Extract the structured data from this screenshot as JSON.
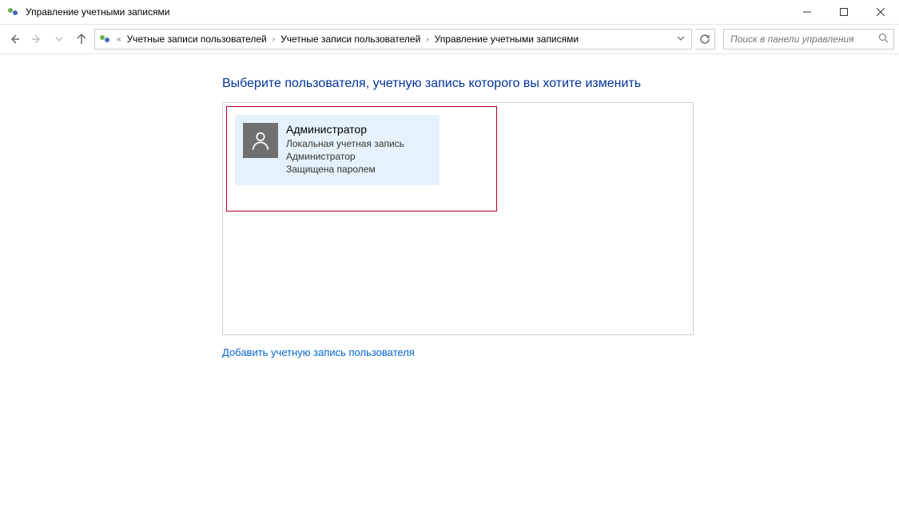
{
  "window": {
    "title": "Управление учетными записями"
  },
  "breadcrumb": {
    "items": [
      "Учетные записи пользователей",
      "Учетные записи пользователей",
      "Управление учетными записями"
    ]
  },
  "search": {
    "placeholder": "Поиск в панели управления"
  },
  "page": {
    "heading": "Выберите пользователя, учетную запись которого вы хотите изменить",
    "add_link": "Добавить учетную запись пользователя"
  },
  "user": {
    "name": "Администратор",
    "line1": "Локальная учетная запись",
    "line2": "Администратор",
    "line3": "Защищена паролем"
  }
}
